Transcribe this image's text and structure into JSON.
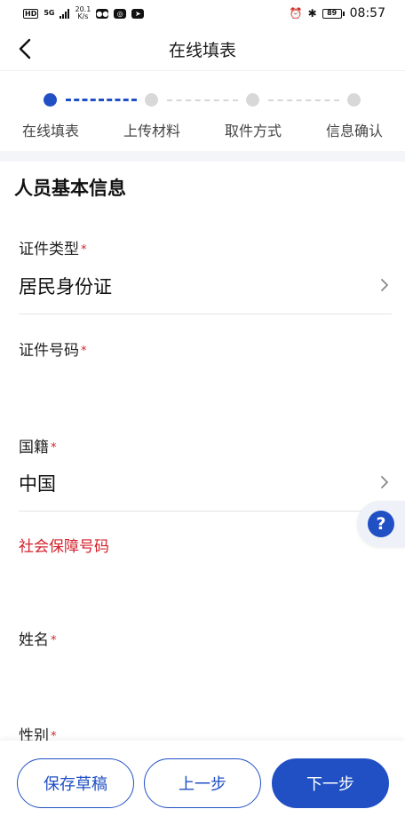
{
  "status_bar": {
    "hd": "HD",
    "network": "5G",
    "speed_value": "20.1",
    "speed_unit": "K/s",
    "battery": "89",
    "time": "08:57"
  },
  "header": {
    "title": "在线填表"
  },
  "steps": [
    {
      "label": "在线填表",
      "active": true
    },
    {
      "label": "上传材料",
      "active": false
    },
    {
      "label": "取件方式",
      "active": false
    },
    {
      "label": "信息确认",
      "active": false
    }
  ],
  "form": {
    "section_title": "人员基本信息",
    "required_mark": "*",
    "id_type": {
      "label": "证件类型",
      "value": "居民身份证"
    },
    "id_number": {
      "label": "证件号码",
      "value": ""
    },
    "nationality": {
      "label": "国籍",
      "value": "中国"
    },
    "social_security": {
      "label": "社会保障号码",
      "value": ""
    },
    "name": {
      "label": "姓名",
      "value": ""
    },
    "gender": {
      "label": "性别",
      "value": ""
    }
  },
  "help": {
    "symbol": "?"
  },
  "buttons": {
    "save_draft": "保存草稿",
    "prev_step": "上一步",
    "next_step": "下一步"
  },
  "colors": {
    "primary": "#2050c4",
    "required": "#d4202a"
  }
}
